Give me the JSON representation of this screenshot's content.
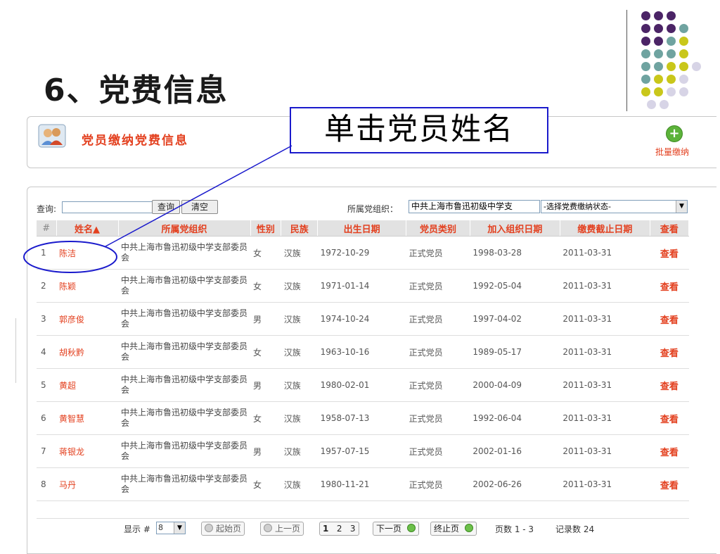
{
  "slide": {
    "title": "6、党费信息"
  },
  "callout": {
    "text": "单击党员姓名"
  },
  "panel": {
    "title": "党员缴纳党费信息",
    "batch_label": "批量缴纳"
  },
  "toolbar": {
    "query_label": "查询:",
    "query_value": "",
    "query_button": "查询",
    "clear_button": "清空",
    "org_label": "所属党组织：",
    "org_value": "中共上海市鲁迅初级中学支",
    "status_value": "-选择党费缴纳状态-"
  },
  "table": {
    "headers": [
      "#",
      "姓名▲",
      "所属党组织",
      "性别",
      "民族",
      "出生日期",
      "党员类别",
      "加入组织日期",
      "缴费截止日期",
      "查看"
    ],
    "rows": [
      {
        "num": "1",
        "name": "陈洁",
        "org": "中共上海市鲁迅初级中学支部委员会",
        "gender": "女",
        "ethnicity": "汉族",
        "birth": "1972-10-29",
        "category": "正式党员",
        "joined": "1998-03-28",
        "deadline": "2011-03-31",
        "view": "查看"
      },
      {
        "num": "2",
        "name": "陈颖",
        "org": "中共上海市鲁迅初级中学支部委员会",
        "gender": "女",
        "ethnicity": "汉族",
        "birth": "1971-01-14",
        "category": "正式党员",
        "joined": "1992-05-04",
        "deadline": "2011-03-31",
        "view": "查看"
      },
      {
        "num": "3",
        "name": "郭彦俊",
        "org": "中共上海市鲁迅初级中学支部委员会",
        "gender": "男",
        "ethnicity": "汉族",
        "birth": "1974-10-24",
        "category": "正式党员",
        "joined": "1997-04-02",
        "deadline": "2011-03-31",
        "view": "查看"
      },
      {
        "num": "4",
        "name": "胡秋黔",
        "org": "中共上海市鲁迅初级中学支部委员会",
        "gender": "女",
        "ethnicity": "汉族",
        "birth": "1963-10-16",
        "category": "正式党员",
        "joined": "1989-05-17",
        "deadline": "2011-03-31",
        "view": "查看"
      },
      {
        "num": "5",
        "name": "黄超",
        "org": "中共上海市鲁迅初级中学支部委员会",
        "gender": "男",
        "ethnicity": "汉族",
        "birth": "1980-02-01",
        "category": "正式党员",
        "joined": "2000-04-09",
        "deadline": "2011-03-31",
        "view": "查看"
      },
      {
        "num": "6",
        "name": "黄智慧",
        "org": "中共上海市鲁迅初级中学支部委员会",
        "gender": "女",
        "ethnicity": "汉族",
        "birth": "1958-07-13",
        "category": "正式党员",
        "joined": "1992-06-04",
        "deadline": "2011-03-31",
        "view": "查看"
      },
      {
        "num": "7",
        "name": "蒋银龙",
        "org": "中共上海市鲁迅初级中学支部委员会",
        "gender": "男",
        "ethnicity": "汉族",
        "birth": "1957-07-15",
        "category": "正式党员",
        "joined": "2002-01-16",
        "deadline": "2011-03-31",
        "view": "查看"
      },
      {
        "num": "8",
        "name": "马丹",
        "org": "中共上海市鲁迅初级中学支部委员会",
        "gender": "女",
        "ethnicity": "汉族",
        "birth": "1980-11-21",
        "category": "正式党员",
        "joined": "2002-06-26",
        "deadline": "2011-03-31",
        "view": "查看"
      }
    ]
  },
  "pager": {
    "show_label": "显示 #",
    "per_page": "8",
    "first": "起始页",
    "prev": "上一页",
    "pages": [
      "1",
      "2",
      "3"
    ],
    "next": "下一页",
    "last": "终止页",
    "page_info": "页数 1 - 3",
    "record_info": "记录数 24"
  },
  "colors": {
    "accent": "#e3401f",
    "header_bg": "#e2e2e2",
    "callout_border": "#1a1acc",
    "dot_purple": "#4b2466",
    "dot_teal": "#6fa3a0",
    "dot_yellow": "#c9c71a",
    "dot_lavender": "#d7d4e6"
  }
}
